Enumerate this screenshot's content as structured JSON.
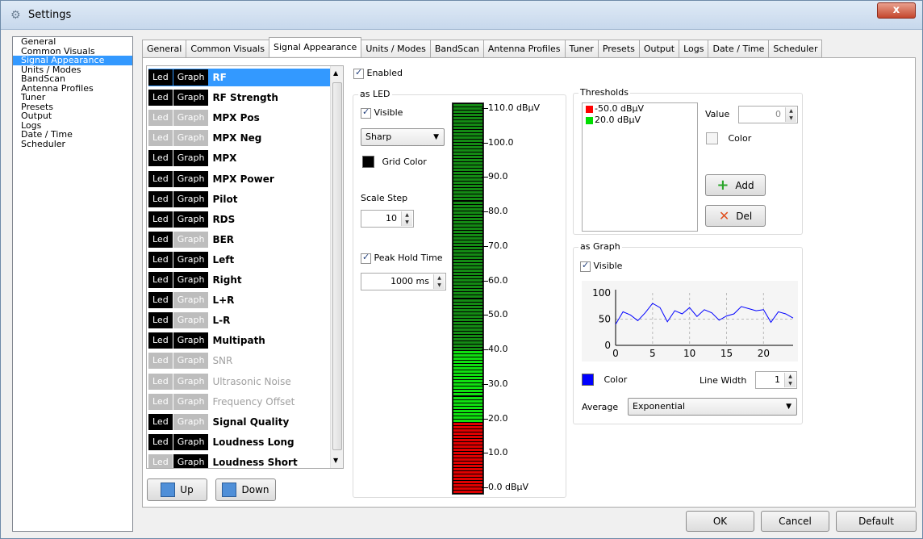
{
  "window": {
    "title": "Settings",
    "close_label": "x"
  },
  "nav": {
    "items": [
      "General",
      "Common Visuals",
      "Signal Appearance",
      "Units / Modes",
      "BandScan",
      "Antenna Profiles",
      "Tuner",
      "Presets",
      "Output",
      "Logs",
      "Date / Time",
      "Scheduler"
    ],
    "selected": "Signal Appearance"
  },
  "tabs": {
    "items": [
      "General",
      "Common Visuals",
      "Signal Appearance",
      "Units / Modes",
      "BandScan",
      "Antenna Profiles",
      "Tuner",
      "Presets",
      "Output",
      "Logs",
      "Date / Time",
      "Scheduler"
    ],
    "active": "Signal Appearance"
  },
  "signals": {
    "led_label": "Led",
    "graph_label": "Graph",
    "rows": [
      {
        "name": "RF",
        "led": true,
        "graph": true,
        "enabled": true,
        "selected": true
      },
      {
        "name": "RF Strength",
        "led": true,
        "graph": true,
        "enabled": true
      },
      {
        "name": "MPX Pos",
        "led": false,
        "graph": false,
        "enabled": true
      },
      {
        "name": "MPX Neg",
        "led": false,
        "graph": false,
        "enabled": true
      },
      {
        "name": "MPX",
        "led": true,
        "graph": true,
        "enabled": true
      },
      {
        "name": "MPX Power",
        "led": true,
        "graph": true,
        "enabled": true
      },
      {
        "name": "Pilot",
        "led": true,
        "graph": true,
        "enabled": true
      },
      {
        "name": "RDS",
        "led": true,
        "graph": true,
        "enabled": true
      },
      {
        "name": "BER",
        "led": true,
        "graph": false,
        "enabled": true
      },
      {
        "name": "Left",
        "led": true,
        "graph": true,
        "enabled": true
      },
      {
        "name": "Right",
        "led": true,
        "graph": true,
        "enabled": true
      },
      {
        "name": "L+R",
        "led": true,
        "graph": false,
        "enabled": true
      },
      {
        "name": "L-R",
        "led": true,
        "graph": false,
        "enabled": true
      },
      {
        "name": "Multipath",
        "led": true,
        "graph": true,
        "enabled": true
      },
      {
        "name": "SNR",
        "led": false,
        "graph": false,
        "enabled": false
      },
      {
        "name": "Ultrasonic Noise",
        "led": false,
        "graph": false,
        "enabled": false
      },
      {
        "name": "Frequency Offset",
        "led": false,
        "graph": false,
        "enabled": false
      },
      {
        "name": "Signal Quality",
        "led": true,
        "graph": false,
        "enabled": true
      },
      {
        "name": "Loudness Long",
        "led": true,
        "graph": true,
        "enabled": true
      },
      {
        "name": "Loudness Short",
        "led": false,
        "graph": true,
        "enabled": true
      }
    ]
  },
  "list_buttons": {
    "up": "Up",
    "down": "Down"
  },
  "enabled_label": "Enabled",
  "as_led": {
    "title": "as LED",
    "visible_label": "Visible",
    "style_value": "Sharp",
    "grid_color_label": "Grid Color",
    "scale_step_label": "Scale Step",
    "scale_step_value": "10",
    "peak_hold_label": "Peak Hold Time",
    "peak_hold_value": "1000 ms",
    "scale": [
      "110.0 dBµV",
      "100.0",
      "90.0",
      "80.0",
      "70.0",
      "60.0",
      "50.0",
      "40.0",
      "30.0",
      "20.0",
      "10.0",
      "0.0 dBµV"
    ]
  },
  "thresholds": {
    "title": "Thresholds",
    "items": [
      {
        "label": "-50.0 dBµV",
        "color": "#ff0000"
      },
      {
        "label": "20.0 dBµV",
        "color": "#00dd00"
      }
    ],
    "value_label": "Value",
    "value": "0",
    "color_label": "Color",
    "add_label": "Add",
    "del_label": "Del"
  },
  "as_graph": {
    "title": "as Graph",
    "visible_label": "Visible",
    "color_label": "Color",
    "line_width_label": "Line Width",
    "line_width_value": "1",
    "average_label": "Average",
    "average_value": "Exponential",
    "line_color": "#0000ff"
  },
  "chart_data": {
    "type": "line",
    "x": [
      0,
      1,
      2,
      3,
      4,
      5,
      6,
      7,
      8,
      9,
      10,
      11,
      12,
      13,
      14,
      15,
      16,
      17,
      18,
      19,
      20,
      21,
      22,
      23,
      24
    ],
    "values": [
      40,
      64,
      58,
      47,
      62,
      80,
      72,
      45,
      66,
      60,
      72,
      55,
      68,
      62,
      48,
      56,
      60,
      74,
      70,
      66,
      68,
      44,
      64,
      60,
      52
    ],
    "xticks": [
      "0",
      "5",
      "10",
      "15",
      "20"
    ],
    "yticks": [
      "0",
      "50",
      "100"
    ],
    "ylim": [
      0,
      100
    ]
  },
  "footer": {
    "ok": "OK",
    "cancel": "Cancel",
    "default": "Default"
  }
}
